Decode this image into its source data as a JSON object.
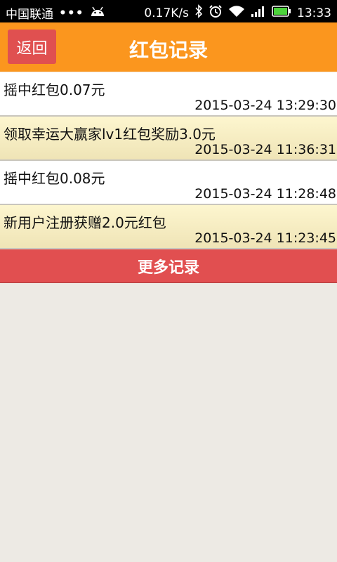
{
  "statusbar": {
    "carrier": "中国联通",
    "dots": "•••",
    "network_speed": "0.17K/s",
    "time": "13:33",
    "battery_color": "#4cd33b"
  },
  "header": {
    "back_label": "返回",
    "title": "红包记录",
    "bg_color": "#fb961e"
  },
  "records": [
    {
      "desc": "摇中红包0.07元",
      "time": "2015-03-24 13:29:30",
      "style": "white"
    },
    {
      "desc": "领取幸运大赢家lv1红包奖励3.0元",
      "time": "2015-03-24 11:36:31",
      "style": "yellow"
    },
    {
      "desc": "摇中红包0.08元",
      "time": "2015-03-24 11:28:48",
      "style": "white"
    },
    {
      "desc": "新用户注册获赠2.0元红包",
      "time": "2015-03-24 11:23:45",
      "style": "yellow"
    }
  ],
  "more_button": {
    "label": "更多记录"
  }
}
